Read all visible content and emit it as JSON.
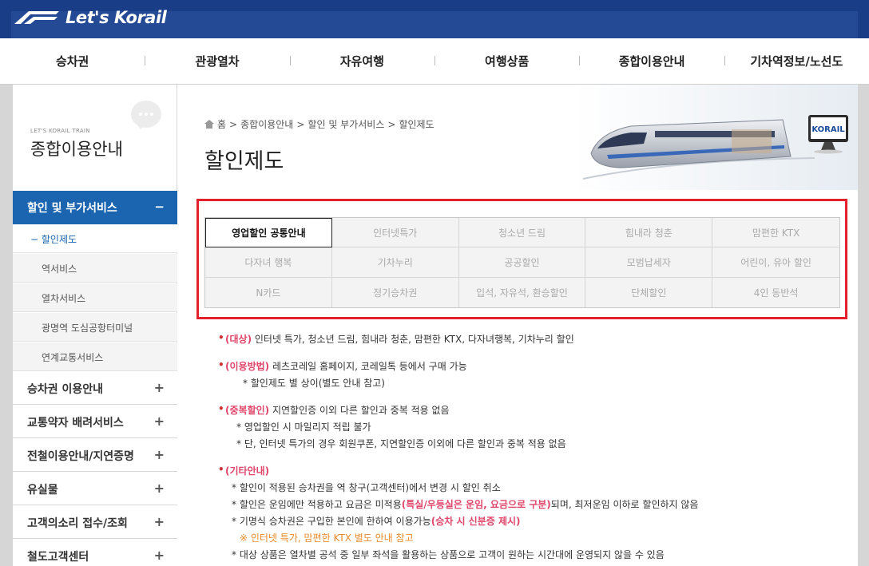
{
  "brand": {
    "logo_text": "Let's Korail"
  },
  "main_nav": [
    "승차권",
    "관광열차",
    "자유여행",
    "여행상품",
    "종합이용안내",
    "기차역정보/노선도"
  ],
  "sidebar": {
    "small_label": "LET'S KORAIL TRAIN",
    "title": "종합이용안내",
    "active_section": {
      "label": "할인 및 부가서비스",
      "toggle": "−"
    },
    "sub_items": [
      "할인제도",
      "역서비스",
      "열차서비스",
      "광명역 도심공항터미널",
      "연계교통서비스"
    ],
    "sub_prefix": "−",
    "sections": [
      {
        "label": "승차권 이용안내",
        "toggle": "+"
      },
      {
        "label": "교통약자 배려서비스",
        "toggle": "+"
      },
      {
        "label": "전철이용안내/지연증명",
        "toggle": "+"
      },
      {
        "label": "유실물",
        "toggle": "+"
      },
      {
        "label": "고객의소리 접수/조회",
        "toggle": "+"
      },
      {
        "label": "철도고객센터",
        "toggle": "+"
      }
    ]
  },
  "breadcrumb": [
    "홈",
    "종합이용안내",
    "할인 및 부가서비스",
    "할인제도"
  ],
  "breadcrumb_sep": ">",
  "page_title": "할인제도",
  "train_brand": "KORAIL",
  "tabs": [
    "영업할인 공통안내",
    "인터넷특가",
    "청소년 드림",
    "힘내라 청춘",
    "맘편한 KTX",
    "다자녀 행복",
    "기차누리",
    "공공할인",
    "모범납세자",
    "어린이, 유아 할인",
    "N카드",
    "정기승차권",
    "입석, 자유석, 환승할인",
    "단체할인",
    "4인 동반석"
  ],
  "selected_tab": 0,
  "info": {
    "b1": {
      "tag": "(대상)",
      "text": " 인터넷 특가, 청소년 드림, 힘내라 청춘, 맘편한 KTX, 다자녀행복, 기차누리 할인"
    },
    "b2": {
      "tag": "(이용방법)",
      "text": " 레츠코레일 홈페이지, 코레일톡 등에서 구매 가능",
      "sub": "* 할인제도 별 상이(별도 안내 참고)"
    },
    "b3": {
      "tag": "(중복할인)",
      "text": " 지연할인증 이외 다른 할인과 중복 적용 없음",
      "sub1": "* 영업할인 시 마일리지 적립 불가",
      "sub2": "* 단, 인터넷 특가의 경우 회원쿠폰, 지연할인증 이외에 다른 할인과 중복 적용 없음"
    },
    "b4": {
      "tag": "(기타안내)",
      "l1": "* 할인이 적용된 승차권을 역 창구(고객센터)에서 변경 시 할인 취소",
      "l2a": "* 할인은 운임에만 적용하고 요금은 미적용",
      "l2b": "(특실/우등실은 운임, 요금으로 구분)",
      "l2c": "되며, 최저운임 이하로 할인하지 않음",
      "l3a": "* 기명식 승차권은 구입한 본인에 한하여 이용가능",
      "l3b": "(승차 시 신분증 제시)",
      "l4": "※ 인터넷 특가, 맘편한 KTX 별도 안내 참고",
      "l5": "* 대상 상품은 열차별 공석 중 일부 좌석을 활용하는 상품으로 고객이 원하는 시간대에 운영되지 않을 수 있음"
    }
  },
  "colors": {
    "brand_blue": "#1a3d87",
    "active_blue": "#1a64b0",
    "highlight_red": "#e3202b",
    "accent_pink": "#e0456a",
    "note_orange": "#e98a2b"
  }
}
